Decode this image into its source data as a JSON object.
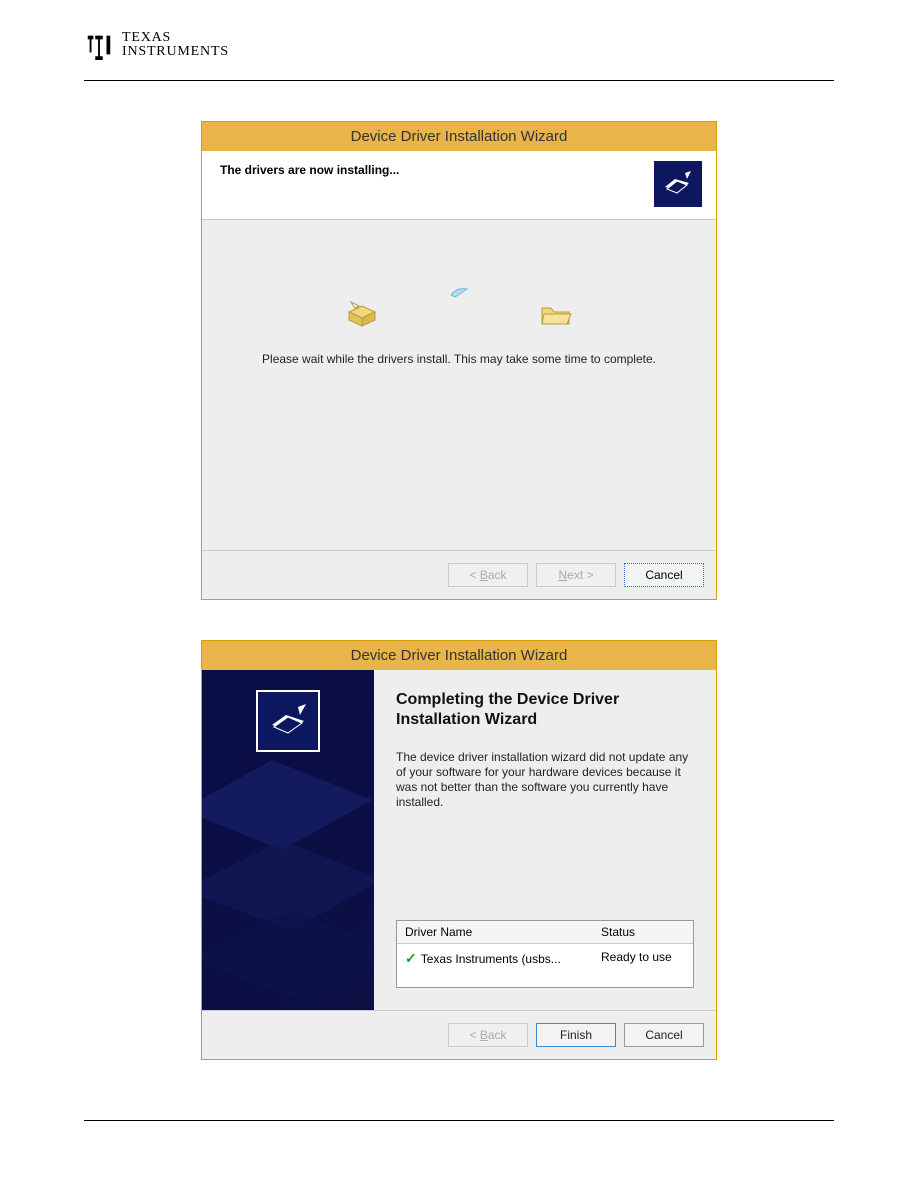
{
  "brand": {
    "line1": "TEXAS",
    "line2": "INSTRUMENTS"
  },
  "dialog1": {
    "title": "Device Driver Installation Wizard",
    "header": "The drivers are now installing...",
    "message": "Please wait while the drivers install. This may take some time to complete.",
    "buttons": {
      "back": "< Back",
      "next": "Next >",
      "cancel": "Cancel"
    }
  },
  "dialog2": {
    "title": "Device Driver Installation Wizard",
    "heading": "Completing the Device Driver Installation Wizard",
    "paragraph": "The device driver installation wizard did not update any of your software for your hardware devices because it was not better than the software you currently have installed.",
    "table": {
      "col_name": "Driver Name",
      "col_status": "Status",
      "row_name": "Texas Instruments (usbs...",
      "row_status": "Ready to use"
    },
    "buttons": {
      "back": "< Back",
      "finish": "Finish",
      "cancel": "Cancel"
    }
  }
}
